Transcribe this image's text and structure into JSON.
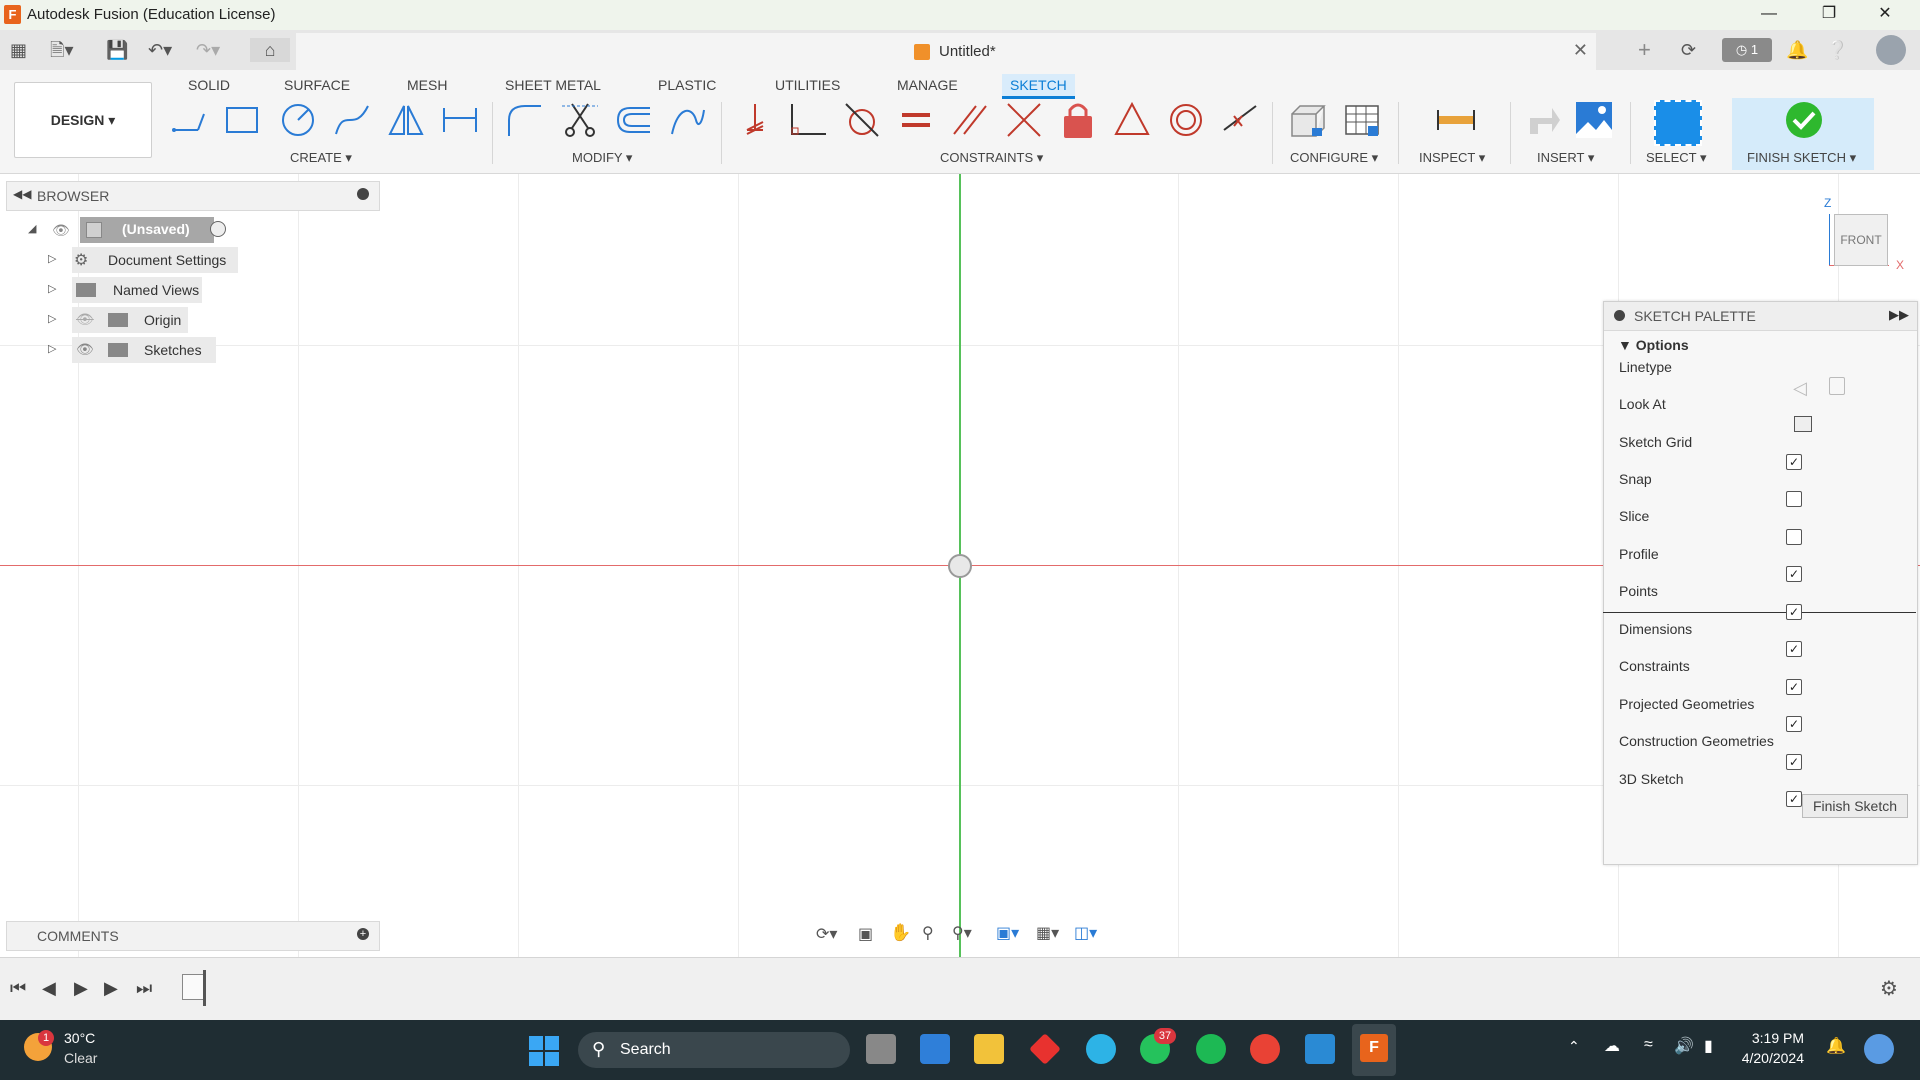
{
  "window": {
    "title": "Autodesk Fusion (Education License)",
    "app_logo_letter": "F",
    "controls": [
      "minimize",
      "maximize",
      "close"
    ]
  },
  "quick_access": {
    "document_title": "Untitled*",
    "job_count": "1"
  },
  "workspace": {
    "label": "DESIGN ▾"
  },
  "ribbon_tabs": [
    "SOLID",
    "SURFACE",
    "MESH",
    "SHEET METAL",
    "PLASTIC",
    "UTILITIES",
    "MANAGE",
    "SKETCH"
  ],
  "active_tab": "SKETCH",
  "groups": {
    "create": "CREATE ▾",
    "modify": "MODIFY ▾",
    "constraints": "CONSTRAINTS ▾",
    "configure": "CONFIGURE ▾",
    "inspect": "INSPECT ▾",
    "insert": "INSERT ▾",
    "select": "SELECT ▾",
    "finish": "FINISH SKETCH ▾"
  },
  "browser": {
    "header": "BROWSER",
    "items": [
      {
        "label": "(Unsaved)"
      },
      {
        "label": "Document Settings"
      },
      {
        "label": "Named Views"
      },
      {
        "label": "Origin"
      },
      {
        "label": "Sketches"
      }
    ]
  },
  "comments": {
    "header": "COMMENTS"
  },
  "viewcube": {
    "face": "FRONT",
    "axis_z": "Z",
    "axis_x": "X"
  },
  "sketch_palette": {
    "header": "SKETCH PALETTE",
    "section": "Options",
    "options": [
      {
        "label": "Linetype"
      },
      {
        "label": "Look At"
      },
      {
        "label": "Sketch Grid",
        "checked": true
      },
      {
        "label": "Snap",
        "checked": false
      },
      {
        "label": "Slice",
        "checked": false
      },
      {
        "label": "Profile",
        "checked": true
      },
      {
        "label": "Points",
        "checked": true
      },
      {
        "label": "Dimensions",
        "checked": true
      },
      {
        "label": "Constraints",
        "checked": true
      },
      {
        "label": "Projected Geometries",
        "checked": true
      },
      {
        "label": "Construction Geometries",
        "checked": true
      },
      {
        "label": "3D Sketch",
        "checked": true
      }
    ],
    "finish_button": "Finish Sketch"
  },
  "taskbar": {
    "weather_temp": "30°C",
    "weather_desc": "Clear",
    "weather_badge": "1",
    "search_label": "Search",
    "whatsapp_badge": "37",
    "time": "3:19 PM",
    "date": "4/20/2024"
  },
  "colors": {
    "accent": "#0b7ed6",
    "x_axis": "#e36b6b",
    "y_axis": "#56c15a",
    "finish_green": "#2eb82e",
    "taskbar": "#1f2d33"
  }
}
